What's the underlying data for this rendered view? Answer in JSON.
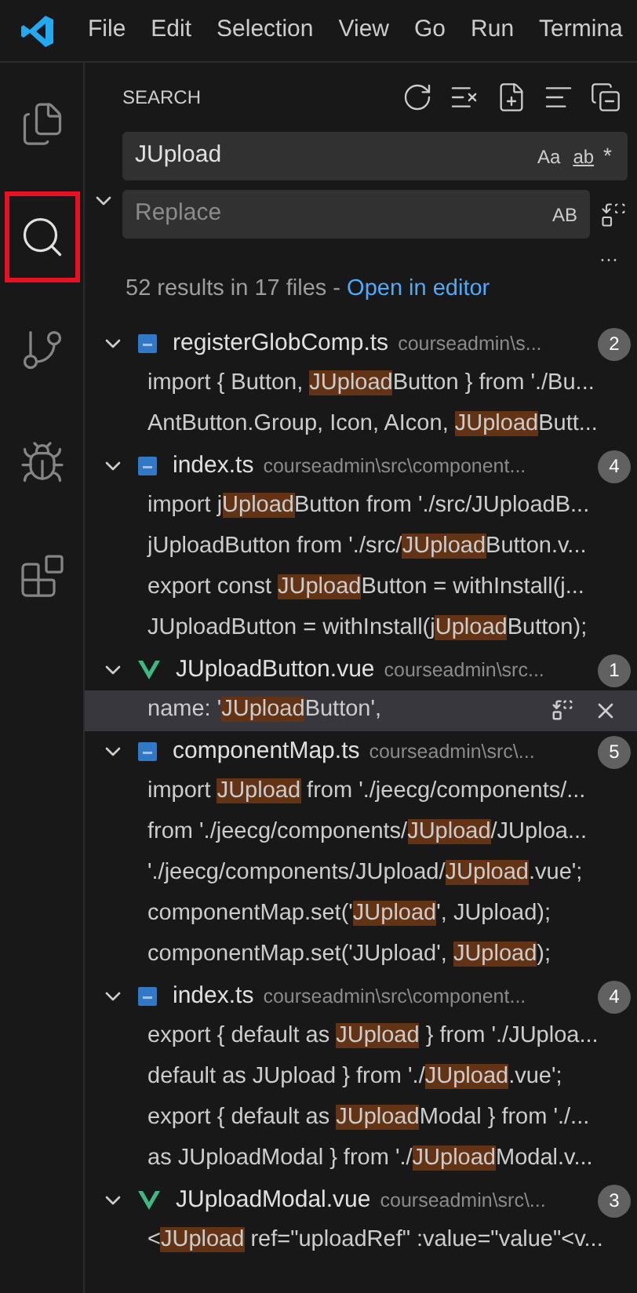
{
  "menu_bar": {
    "items": [
      "File",
      "Edit",
      "Selection",
      "View",
      "Go",
      "Run",
      "Termina"
    ]
  },
  "activity_bar": {
    "items": [
      {
        "kind": "files",
        "selected": false,
        "highlighted": false
      },
      {
        "kind": "search",
        "selected": true,
        "highlighted": true
      },
      {
        "kind": "source-control",
        "selected": false,
        "highlighted": false
      },
      {
        "kind": "debug",
        "selected": false,
        "highlighted": false
      },
      {
        "kind": "extensions",
        "selected": false,
        "highlighted": false
      }
    ]
  },
  "search_panel": {
    "title": "SEARCH",
    "search_value": "JUpload",
    "toggles": [
      "Aa",
      "ab",
      "*"
    ],
    "replace_placeholder": "Replace",
    "replace_toggle": "AB",
    "more": "···",
    "summary": "52 results in 17 files - ",
    "open_in_editor": "Open in editor"
  },
  "results": [
    {
      "file": "registerGlobComp.ts",
      "kind": "ts",
      "path": "courseadmin\\s...",
      "count": "2",
      "expanded": true,
      "matches": [
        {
          "before": "import { Button, ",
          "match": "JUpload",
          "after": "Button } from './Bu...",
          "selected": false
        },
        {
          "before": "AntButton.Group, Icon, AIcon, ",
          "match": "JUpload",
          "after": "Butt...",
          "selected": false
        }
      ]
    },
    {
      "file": "index.ts",
      "kind": "ts",
      "path": "courseadmin\\src\\component...",
      "count": "4",
      "expanded": true,
      "matches": [
        {
          "before": "import j",
          "match": "Upload",
          "after": "Button from './src/JUploadB...",
          "selected": false
        },
        {
          "before": "jUploadButton from './src/",
          "match": "JUpload",
          "after": "Button.v...",
          "selected": false
        },
        {
          "before": "export const ",
          "match": "JUpload",
          "after": "Button = withInstall(j...",
          "selected": false
        },
        {
          "before": "JUploadButton = withInstall(j",
          "match": "Upload",
          "after": "Button);",
          "selected": false
        }
      ]
    },
    {
      "file": "JUploadButton.vue",
      "kind": "vue",
      "path": "courseadmin\\src...",
      "count": "1",
      "expanded": true,
      "matches": [
        {
          "before": "name: '",
          "match": "JUpload",
          "after": "Button',",
          "selected": true
        }
      ]
    },
    {
      "file": "componentMap.ts",
      "kind": "ts",
      "path": "courseadmin\\src\\...",
      "count": "5",
      "expanded": true,
      "matches": [
        {
          "before": "import ",
          "match": "JUpload",
          "after": " from './jeecg/components/...",
          "selected": false
        },
        {
          "before": "from './jeecg/components/",
          "match": "JUpload",
          "after": "/JUploa...",
          "selected": false
        },
        {
          "before": "'./jeecg/components/JUpload/",
          "match": "JUpload",
          "after": ".vue';",
          "selected": false
        },
        {
          "before": "componentMap.set('",
          "match": "JUpload",
          "after": "', JUpload);",
          "selected": false
        },
        {
          "before": "componentMap.set('JUpload', ",
          "match": "JUpload",
          "after": ");",
          "selected": false
        }
      ]
    },
    {
      "file": "index.ts",
      "kind": "ts",
      "path": "courseadmin\\src\\component...",
      "count": "4",
      "expanded": true,
      "matches": [
        {
          "before": "export { default as ",
          "match": "JUpload",
          "after": " } from './JUploa...",
          "selected": false
        },
        {
          "before": "default as JUpload } from './",
          "match": "JUpload",
          "after": ".vue';",
          "selected": false
        },
        {
          "before": "export { default as ",
          "match": "JUpload",
          "after": "Modal } from './...",
          "selected": false
        },
        {
          "before": "as JUploadModal } from './",
          "match": "JUpload",
          "after": "Modal.v...",
          "selected": false
        }
      ]
    },
    {
      "file": "JUploadModal.vue",
      "kind": "vue",
      "path": "courseadmin\\src\\...",
      "count": "3",
      "expanded": true,
      "matches": [
        {
          "before": "<",
          "match": "JUpload",
          "after": " ref=\"uploadRef\" :value=\"value\"<v...",
          "selected": false
        }
      ]
    }
  ]
}
